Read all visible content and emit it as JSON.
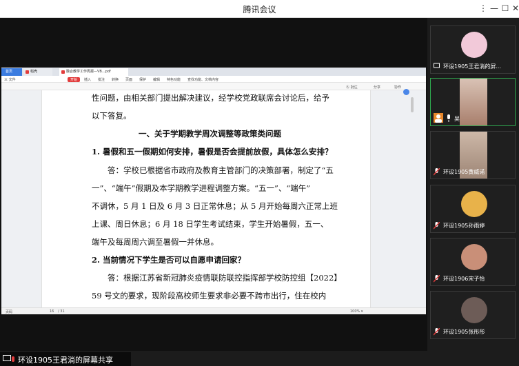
{
  "window": {
    "title": "腾讯会议",
    "controls": [
      "⋮",
      "—",
      "☐",
      "✕"
    ]
  },
  "share": {
    "label": "环设1905王君淌的屏幕共享"
  },
  "wps": {
    "tabs": [
      "首页",
      "稻壳",
      "融合教学工作周报—VB...pdf"
    ],
    "menu": [
      "三 文件",
      "开始",
      "插入",
      "批注",
      "转换",
      "页面",
      "保护",
      "编辑",
      "特色功能",
      "查找功能、文档内容"
    ],
    "tool": [
      "Ⓐ 批注",
      "分享",
      "协作"
    ],
    "status": [
      "页码",
      "16",
      "/ 31",
      "100% ▾"
    ]
  },
  "doc": {
    "lines": [
      {
        "text": "性问题，由相关部门提出解决建议，经学校党政联席会讨论后，给予",
        "bold": false
      },
      {
        "text": "以下答复。",
        "bold": false
      },
      {
        "text": "一、关于学期教学周次调整等政策类问题",
        "bold": true
      },
      {
        "text": "1. 暑假和五一假期如何安排，暑假是否会提前放假，具体怎么安排？",
        "bold": true
      },
      {
        "text": "答：学校已根据省市政府及教育主管部门的决策部署，制定了“五",
        "bold": false
      },
      {
        "text": "一”、“端午”假期及本学期教学进程调整方案。“五一”、“端午”",
        "bold": false
      },
      {
        "text": "不调休，5 月 1 日及 6 月 3 日正常休息；从 5 月开始每周六正常上班",
        "bold": false
      },
      {
        "text": "上课、周日休息；6 月 18 日学生考试结束，学生开始暑假，五一、",
        "bold": false
      },
      {
        "text": "端午及每周周六调至暑假一并休息。",
        "bold": false
      },
      {
        "text": "2.  当前情况下学生是否可以自愿申请回家？",
        "bold": true
      },
      {
        "text": "答：根据江苏省新冠肺炎疫情联防联控指挥部学校防控组【2022】",
        "bold": false
      },
      {
        "text": "59 号文的要求，现阶段高校师生要求非必要不跨市出行，住在校内",
        "bold": false
      }
    ]
  },
  "participants": [
    {
      "name": "环设1905王君淌的屏...",
      "type": "avatar",
      "color": "#f2c9d9"
    },
    {
      "name": "吴",
      "type": "video",
      "color": "#caa08a"
    },
    {
      "name": "环设1905黄威诺",
      "type": "video",
      "color": "#b8a08e"
    },
    {
      "name": "环设1905孙雨婷",
      "type": "avatar",
      "color": "#e8b24a"
    },
    {
      "name": "环设1906宋子怡",
      "type": "avatar",
      "color": "#c98f78"
    },
    {
      "name": "环设1905张彤彤",
      "type": "avatar",
      "color": "#6d5c57"
    }
  ]
}
